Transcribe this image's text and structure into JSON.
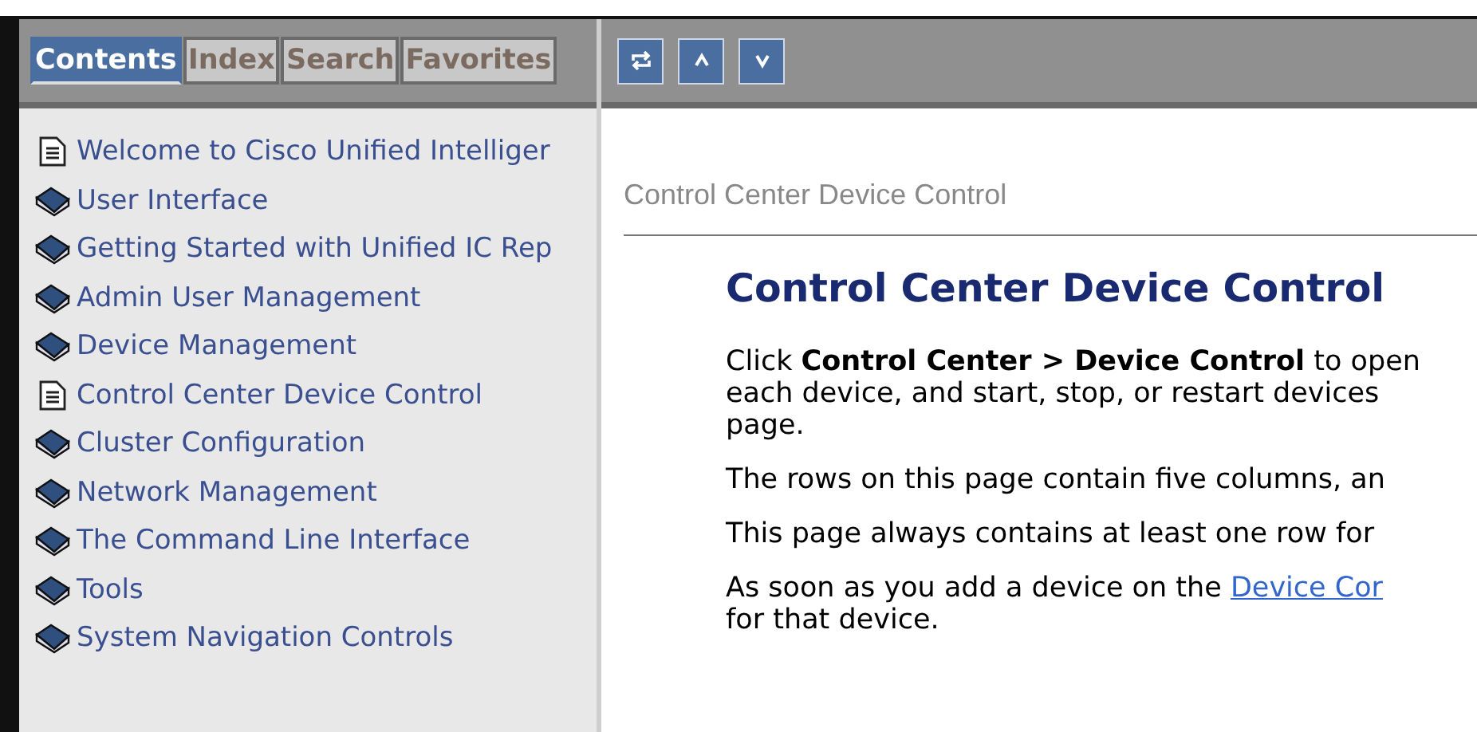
{
  "tabs": [
    {
      "label": "Contents",
      "selected": true
    },
    {
      "label": "Index",
      "selected": false
    },
    {
      "label": "Search",
      "selected": false
    },
    {
      "label": "Favorites",
      "selected": false
    }
  ],
  "toolbar": [
    {
      "kind": "sync"
    },
    {
      "kind": "up"
    },
    {
      "kind": "down"
    }
  ],
  "toc": [
    {
      "kind": "page",
      "label": "Welcome to Cisco Unified Intelliger"
    },
    {
      "kind": "book",
      "label": "User Interface"
    },
    {
      "kind": "book",
      "label": "Getting Started with Unified IC Rep"
    },
    {
      "kind": "book",
      "label": "Admin User Management"
    },
    {
      "kind": "book",
      "label": "Device Management"
    },
    {
      "kind": "page",
      "label": "Control Center Device Control"
    },
    {
      "kind": "book",
      "label": "Cluster Configuration"
    },
    {
      "kind": "book",
      "label": "Network Management"
    },
    {
      "kind": "book",
      "label": "The Command Line Interface"
    },
    {
      "kind": "book",
      "label": "Tools"
    },
    {
      "kind": "book",
      "label": "System Navigation Controls"
    }
  ],
  "breadcrumb": "Control Center Device Control",
  "heading": "Control Center Device Control",
  "paragraphs": [
    {
      "lines": [
        {
          "text": "Click **Control Center > Device Control** to open"
        },
        {
          "text": "each device, and start, stop, or restart devices"
        },
        {
          "text": "page."
        }
      ]
    },
    {
      "lines": [
        {
          "text": "The rows on this page contain five columns, an"
        }
      ]
    },
    {
      "lines": [
        {
          "text": "This page always contains at least one row for"
        }
      ]
    },
    {
      "lines": [
        {
          "text": "As soon as you add a device on the",
          "link": "Device Cor"
        },
        {
          "text": "for that device."
        }
      ]
    }
  ]
}
